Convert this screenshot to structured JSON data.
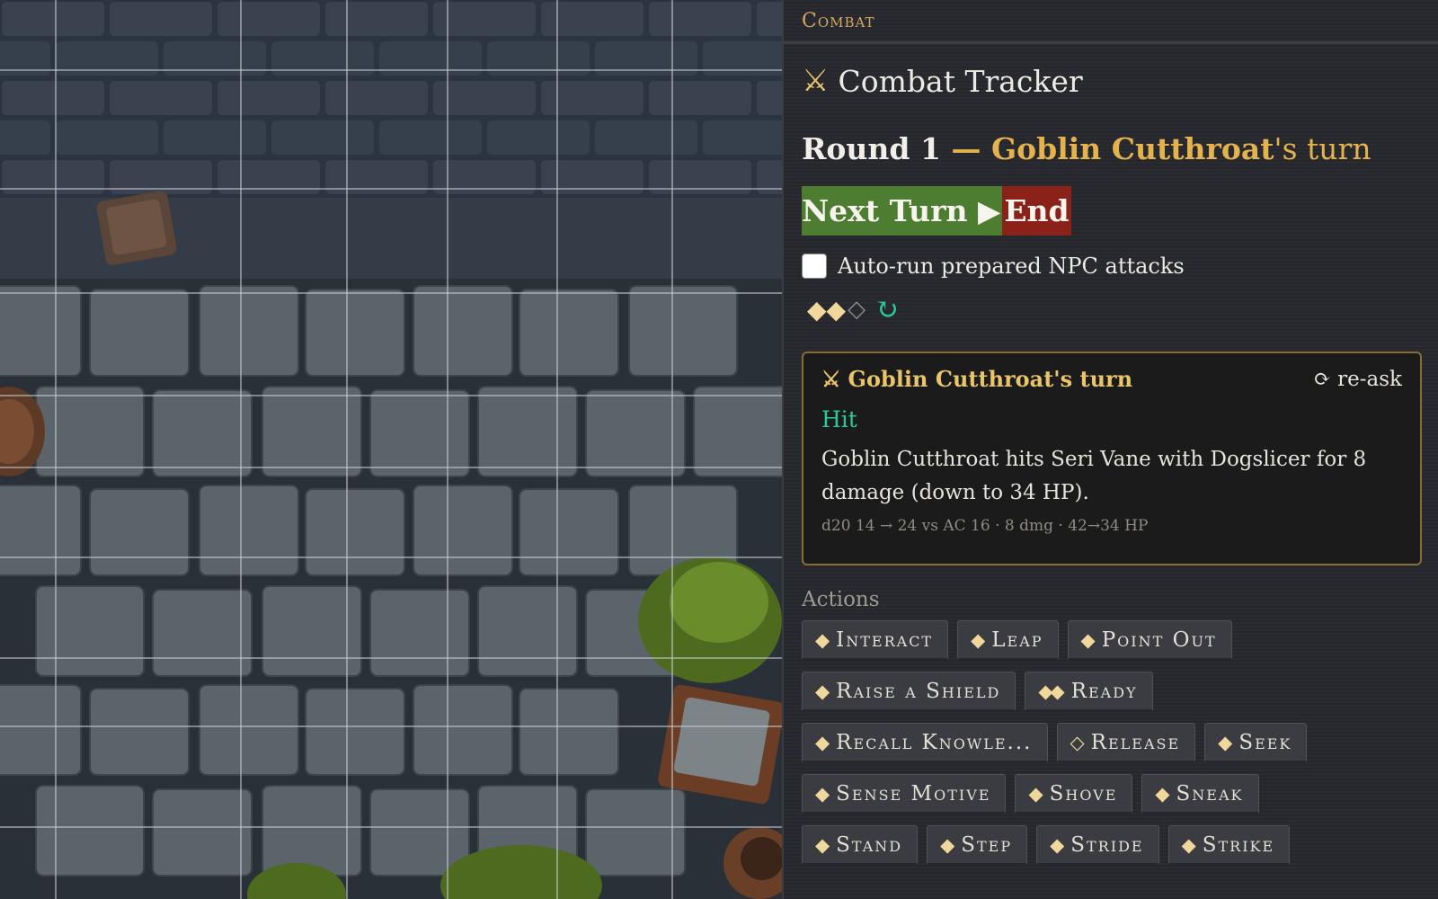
{
  "panel": {
    "header": "Combat"
  },
  "tracker": {
    "title": "Combat Tracker",
    "icon": "crossed-swords-icon"
  },
  "round": {
    "prefix": "Round 1",
    "dash": " — ",
    "name": "Goblin Cutthroat",
    "suffix": "'s turn"
  },
  "buttons": {
    "next_turn": "Next Turn ▶",
    "end": "End"
  },
  "auto_run": {
    "label": "Auto-run prepared NPC attacks",
    "checked": false
  },
  "action_pips": {
    "full": "◆◆",
    "empty": "◇",
    "refresh": "↻"
  },
  "result": {
    "title": "Goblin Cutthroat's turn",
    "title_icon": "⚔",
    "reask": "⟳ re-ask",
    "outcome": "Hit",
    "description": "Goblin Cutthroat hits Seri Vane with Dogslicer for 8 damage (down to 34 HP).",
    "math": "d20 14 → 24 vs AC 16 · 8 dmg · 42→34 HP"
  },
  "actions": {
    "label": "Actions",
    "rows": [
      [
        {
          "cost": "◆",
          "label": "Interact"
        },
        {
          "cost": "◆",
          "label": "Leap"
        },
        {
          "cost": "◆",
          "label": "Point Out"
        }
      ],
      [
        {
          "cost": "◆",
          "label": "Raise a Shield"
        },
        {
          "cost": "◆◆",
          "label": "Ready"
        }
      ],
      [
        {
          "cost": "◆",
          "label": "Recall Knowle..."
        },
        {
          "cost": "◇",
          "label": "Release"
        },
        {
          "cost": "◆",
          "label": "Seek"
        }
      ],
      [
        {
          "cost": "◆",
          "label": "Sense Motive"
        },
        {
          "cost": "◆",
          "label": "Shove"
        },
        {
          "cost": "◆",
          "label": "Sneak"
        }
      ],
      [
        {
          "cost": "◆",
          "label": "Stand"
        },
        {
          "cost": "◆",
          "label": "Step"
        },
        {
          "cost": "◆",
          "label": "Stride"
        },
        {
          "cost": "◆",
          "label": "Strike"
        }
      ]
    ]
  }
}
